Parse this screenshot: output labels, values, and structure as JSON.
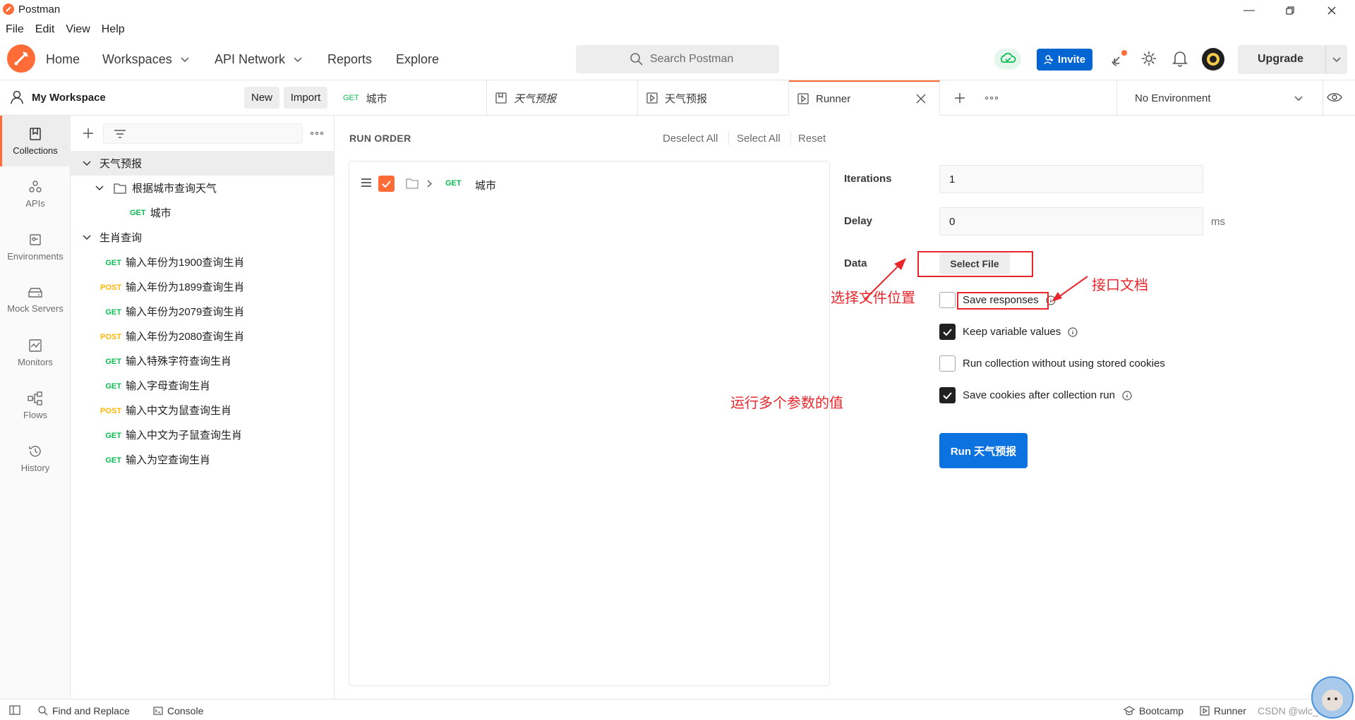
{
  "window": {
    "title": "Postman"
  },
  "menu": [
    "File",
    "Edit",
    "View",
    "Help"
  ],
  "header": {
    "nav": [
      {
        "label": "Home",
        "dropdown": false
      },
      {
        "label": "Workspaces",
        "dropdown": true
      },
      {
        "label": "API Network",
        "dropdown": true
      },
      {
        "label": "Reports",
        "dropdown": false
      },
      {
        "label": "Explore",
        "dropdown": false
      }
    ],
    "search_placeholder": "Search Postman",
    "invite_label": "Invite",
    "upgrade_label": "Upgrade",
    "brand_color": "#ff6c37",
    "invite_color": "#0265d2"
  },
  "workspace": {
    "name": "My Workspace",
    "new_label": "New",
    "import_label": "Import"
  },
  "sidebar": [
    {
      "label": "Collections",
      "icon": "collections-icon",
      "active": true
    },
    {
      "label": "APIs",
      "icon": "apis-icon",
      "active": false
    },
    {
      "label": "Environments",
      "icon": "environments-icon",
      "active": false
    },
    {
      "label": "Mock Servers",
      "icon": "mock-servers-icon",
      "active": false
    },
    {
      "label": "Monitors",
      "icon": "monitors-icon",
      "active": false
    },
    {
      "label": "Flows",
      "icon": "flows-icon",
      "active": false
    },
    {
      "label": "History",
      "icon": "history-icon",
      "active": false
    }
  ],
  "tree": {
    "collection1": "天气预报",
    "folder1": "根据城市查询天气",
    "request1": {
      "method": "GET",
      "name": "城市"
    },
    "collection2": "生肖查询",
    "requests2": [
      {
        "method": "GET",
        "name": "输入年份为1900查询生肖"
      },
      {
        "method": "POST",
        "name": "输入年份为1899查询生肖"
      },
      {
        "method": "GET",
        "name": "输入年份为2079查询生肖"
      },
      {
        "method": "POST",
        "name": "输入年份为2080查询生肖"
      },
      {
        "method": "GET",
        "name": "输入特殊字符查询生肖"
      },
      {
        "method": "GET",
        "name": "输入字母查询生肖"
      },
      {
        "method": "POST",
        "name": "输入中文为鼠查询生肖"
      },
      {
        "method": "GET",
        "name": "输入中文为子鼠查询生肖"
      },
      {
        "method": "GET",
        "name": "输入为空查询生肖"
      }
    ]
  },
  "tabs": [
    {
      "method": "GET",
      "label": "城市"
    },
    {
      "label": "天气预报"
    },
    {
      "label": "天气预报"
    },
    {
      "label": "Runner"
    }
  ],
  "environment": "No Environment",
  "runner": {
    "run_order": "RUN ORDER",
    "deselect_all": "Deselect All",
    "select_all": "Select All",
    "reset": "Reset",
    "item": {
      "method": "GET",
      "name": "城市"
    },
    "iterations_label": "Iterations",
    "iterations_value": "1",
    "delay_label": "Delay",
    "delay_value": "0",
    "delay_unit": "ms",
    "data_label": "Data",
    "select_file": "Select File",
    "options": [
      {
        "label": "Save responses",
        "checked": false
      },
      {
        "label": "Keep variable values",
        "checked": true
      },
      {
        "label": "Run collection without using stored cookies",
        "checked": false
      },
      {
        "label": "Save cookies after collection run",
        "checked": true
      }
    ],
    "run_button": "Run 天气预报"
  },
  "annotations": {
    "select_file_location": "选择文件位置",
    "api_doc": "接口文档",
    "run_multi_params": "运行多个参数的值"
  },
  "status": {
    "find_replace": "Find and Replace",
    "console": "Console",
    "bootcamp": "Bootcamp",
    "runner": "Runner",
    "watermark": "CSDN @wlc_zn"
  }
}
